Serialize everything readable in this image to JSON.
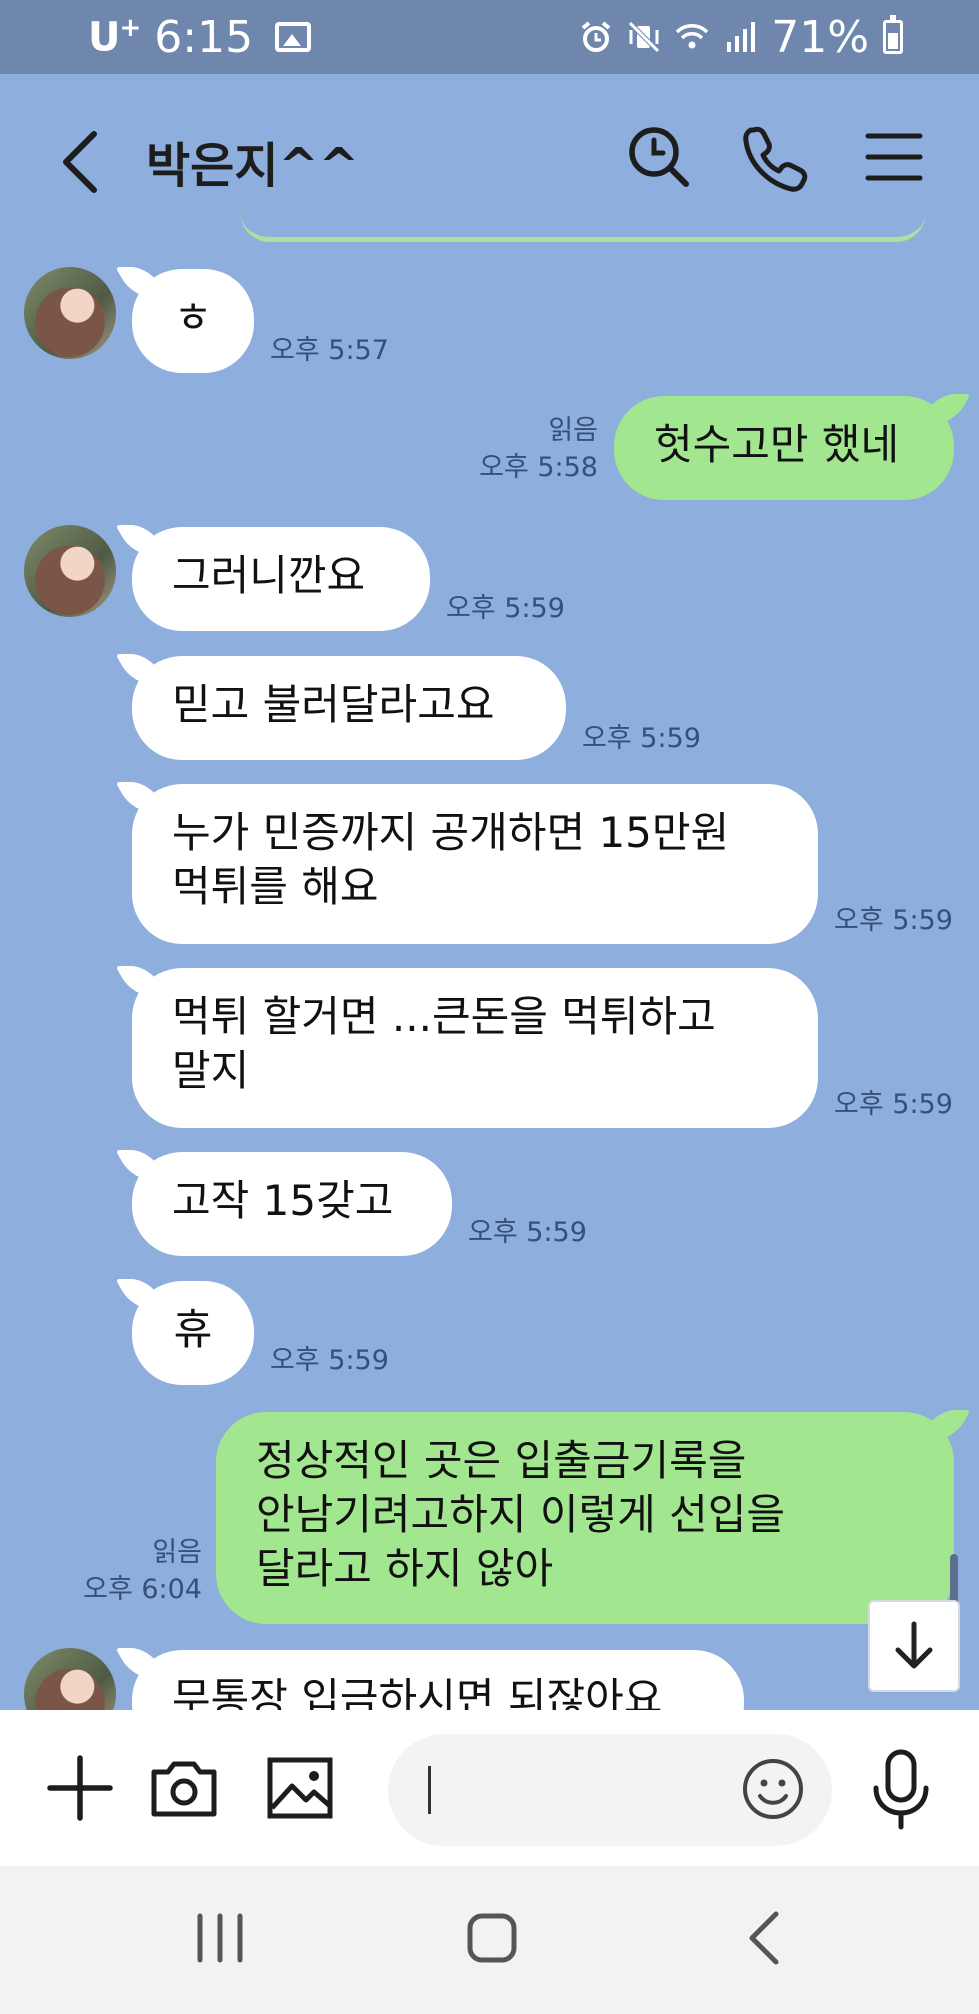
{
  "status_bar": {
    "carrier": "U",
    "carrier_sup": "+",
    "time": "6:15",
    "battery": "71%"
  },
  "header": {
    "title": "박은지^^",
    "icons": [
      "back-arrow-icon",
      "search-icon",
      "phone-icon",
      "menu-icon"
    ]
  },
  "messages": [
    {
      "side": "in",
      "avatar": true,
      "text": "ㅎ",
      "time": "오후 5:57"
    },
    {
      "side": "out",
      "text": "헛수고만 했네",
      "read": "읽음",
      "time": "오후 5:58"
    },
    {
      "side": "in",
      "avatar": true,
      "text": "그러니깐요",
      "time": "오후 5:59"
    },
    {
      "side": "in",
      "text": "믿고 불러달라고요",
      "time": "오후 5:59"
    },
    {
      "side": "in",
      "text": "누가 민증까지 공개하면 15만원\n먹튀를 해요",
      "time": "오후 5:59"
    },
    {
      "side": "in",
      "text": "먹튀 할거면 ...큰돈을 먹튀하고\n말지",
      "time": "오후 5:59"
    },
    {
      "side": "in",
      "text": "고작 15갖고",
      "time": "오후 5:59"
    },
    {
      "side": "in",
      "text": "휴",
      "time": "오후 5:59"
    },
    {
      "side": "out",
      "text": "정상적인 곳은 입출금기록을\n안남기려고하지 이렇게 선입을\n달라고 하지 않아",
      "read": "읽음",
      "time": "오후 6:04"
    },
    {
      "side": "in",
      "avatar": true,
      "text": "무통장 입금하시면 되잖아요",
      "time": ""
    }
  ],
  "input": {
    "placeholder": "",
    "value": ""
  },
  "colors": {
    "chat_bg": "#8eaede",
    "incoming_bubble": "#ffffff",
    "outgoing_bubble": "#a2e68f",
    "status_bar": "#6f87ad"
  }
}
